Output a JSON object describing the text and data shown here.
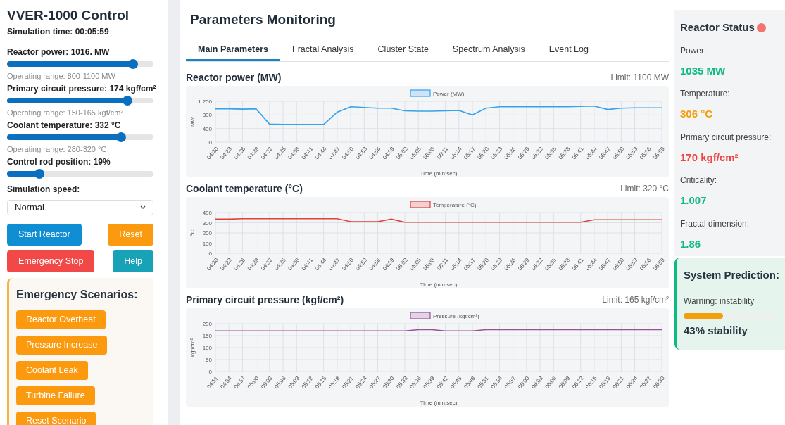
{
  "sidebar": {
    "title": "VVER-1000 Control",
    "sim_time": "Simulation time: 00:05:59",
    "sliders": [
      {
        "label": "Reactor power: 1016.  MW",
        "level": 0.86,
        "hint": "Operating range: 800-1100 MW"
      },
      {
        "label": "Primary circuit pressure: 174 kgf/cm²",
        "level": 0.82,
        "hint": "Operating range: 150-165 kgf/cm²"
      },
      {
        "label": "Coolant temperature: 332 °C",
        "level": 0.78,
        "hint": "Operating range: 280-320 °C"
      },
      {
        "label": "Control rod position: 19%",
        "level": 0.22
      }
    ],
    "speed_label": "Simulation speed:",
    "speed_value": "Normal",
    "buttons": [
      {
        "label": "Start Reactor",
        "color": "#0f8ed4"
      },
      {
        "label": "Reset",
        "color": "#fb9a0e"
      },
      {
        "label": "Emergency Stop",
        "color": "#f24848"
      },
      {
        "label": "Help",
        "color": "#17a2b8"
      }
    ],
    "scenarios_title": "Emergency Scenarios:",
    "scenarios": [
      "Reactor Overheat",
      "Pressure Increase",
      "Coolant Leak",
      "Turbine Failure",
      "Reset Scenario"
    ]
  },
  "main": {
    "title": "Parameters Monitoring",
    "tabs": [
      {
        "label": "Main Parameters",
        "selected": true
      },
      {
        "label": "Fractal Analysis",
        "selected": false
      },
      {
        "label": "Cluster State",
        "selected": false
      },
      {
        "label": "Spectrum Analysis",
        "selected": false
      },
      {
        "label": "Event Log",
        "selected": false
      }
    ],
    "panels": [
      {
        "title": "Reactor power (MW)",
        "limit": "Limit: 1100 MW",
        "chart_data": {
          "type": "line",
          "xlabel": "Time (min:sec)",
          "ylabel": "MW",
          "categories": [
            "04:20",
            "04:23",
            "04:26",
            "04:29",
            "04:32",
            "04:35",
            "04:38",
            "04:41",
            "04:44",
            "04:47",
            "04:50",
            "04:53",
            "04:56",
            "04:59",
            "05:02",
            "05:05",
            "05:08",
            "05:11",
            "05:14",
            "05:17",
            "05:20",
            "05:23",
            "05:26",
            "05:29",
            "05:32",
            "05:35",
            "05:38",
            "05:41",
            "05:44",
            "05:47",
            "05:50",
            "05:53",
            "05:56",
            "05:59"
          ],
          "grid": true,
          "ylim": [
            0,
            1200
          ],
          "yticks": [
            0,
            400,
            800,
            {
              "value": 1200,
              "label": "1 200"
            }
          ],
          "series": [
            {
              "name": "Power (MW)",
              "color": "#36a2eb",
              "values": [
                980,
                980,
                970,
                980,
                530,
                520,
                520,
                520,
                520,
                880,
                1040,
                1020,
                1000,
                1000,
                920,
                910,
                910,
                920,
                930,
                800,
                1000,
                1040,
                1040,
                1040,
                1040,
                1040,
                1040,
                1050,
                1060,
                960,
                1000,
                1010,
                1010,
                1010
              ]
            }
          ]
        }
      },
      {
        "title": "Coolant temperature (°C)",
        "limit": "Limit: 320 °C",
        "chart_data": {
          "type": "line",
          "xlabel": "Time (min:sec)",
          "ylabel": "°C",
          "categories": [
            "04:20",
            "04:23",
            "04:26",
            "04:29",
            "04:32",
            "04:35",
            "04:38",
            "04:41",
            "04:44",
            "04:47",
            "04:50",
            "04:53",
            "04:56",
            "04:59",
            "05:02",
            "05:05",
            "05:08",
            "05:11",
            "05:14",
            "05:17",
            "05:20",
            "05:23",
            "05:26",
            "05:29",
            "05:32",
            "05:35",
            "05:38",
            "05:41",
            "05:44",
            "05:47",
            "05:50",
            "05:53",
            "05:56",
            "05:59"
          ],
          "grid": true,
          "ylim": [
            0,
            400
          ],
          "yticks": [
            0,
            100,
            200,
            300,
            400
          ],
          "series": [
            {
              "name": "Temperature (°C)",
              "color": "#e0413b",
              "values": [
                335,
                335,
                340,
                340,
                340,
                340,
                340,
                340,
                340,
                340,
                310,
                310,
                310,
                335,
                305,
                305,
                305,
                305,
                305,
                305,
                305,
                305,
                305,
                305,
                305,
                305,
                305,
                305,
                330,
                330,
                330,
                330,
                330,
                330
              ]
            }
          ]
        }
      },
      {
        "title": "Primary circuit pressure (kgf/cm²)",
        "limit": "Limit: 165 kgf/cm²",
        "chart_data": {
          "type": "line",
          "xlabel": "Time (min:sec)",
          "ylabel": "kgf/cm²",
          "categories": [
            "04:51",
            "04:54",
            "04:57",
            "05:00",
            "05:03",
            "05:06",
            "05:09",
            "05:12",
            "05:15",
            "05:18",
            "05:21",
            "05:24",
            "05:27",
            "05:30",
            "05:33",
            "05:36",
            "05:39",
            "05:42",
            "05:45",
            "05:48",
            "05:51",
            "05:54",
            "05:57",
            "06:00",
            "06:03",
            "06:06",
            "06:09",
            "06:12",
            "06:15",
            "06:18",
            "06:21",
            "06:24",
            "06:27",
            "06:30"
          ],
          "grid": true,
          "ylim": [
            0,
            200
          ],
          "yticks": [
            0,
            50,
            100,
            150,
            200
          ],
          "series": [
            {
              "name": "Pressure (kgf/cm²)",
              "color": "#9b4f9b",
              "values": [
                170,
                170,
                170,
                170,
                170,
                170,
                170,
                170,
                170,
                170,
                170,
                170,
                170,
                170,
                170,
                175,
                175,
                170,
                170,
                170,
                175,
                175,
                175,
                175,
                175,
                175,
                175,
                175,
                175,
                175,
                175,
                175,
                175,
                175
              ]
            }
          ]
        }
      }
    ]
  },
  "status": {
    "title": "Reactor Status",
    "indicator": {
      "color": "#f87171"
    },
    "items": [
      {
        "label": "Power:",
        "value": "1035 MW",
        "color": "#10b981"
      },
      {
        "label": "Temperature:",
        "value": "306 °C",
        "color": "#f59e0b"
      },
      {
        "label": "Primary circuit pressure:",
        "value": "170 kgf/cm²",
        "color": "#ef4444"
      },
      {
        "label": "Criticality:",
        "value": "1.007",
        "color": "#10b981"
      },
      {
        "label": "Fractal dimension:",
        "value": "1.86",
        "color": "#10b981"
      }
    ],
    "prediction": {
      "title": "System Prediction:",
      "warning": "Warning: instability",
      "level": 0.43,
      "reading": "43% stability"
    }
  }
}
